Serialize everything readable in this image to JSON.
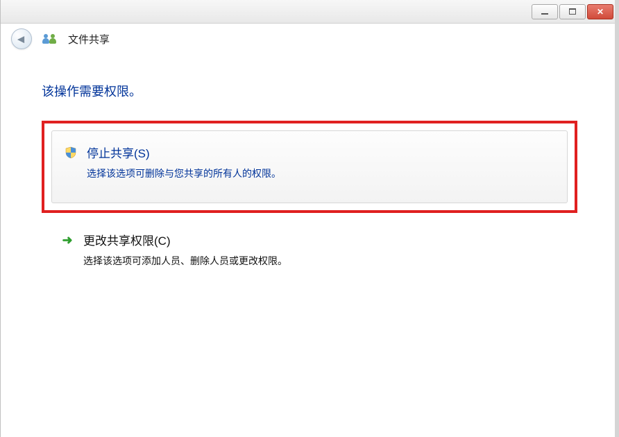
{
  "titlebar": {
    "minimize_label": "Minimize",
    "maximize_label": "Maximize",
    "close_label": "Close"
  },
  "header": {
    "title": "文件共享"
  },
  "content": {
    "heading": "该操作需要权限。",
    "options": [
      {
        "title": "停止共享(S)",
        "description": "选择该选项可删除与您共享的所有人的权限。",
        "highlighted": true,
        "icon": "shield"
      },
      {
        "title": "更改共享权限(C)",
        "description": "选择该选项可添加人员、删除人员或更改权限。",
        "highlighted": false,
        "icon": "arrow-right"
      }
    ]
  }
}
